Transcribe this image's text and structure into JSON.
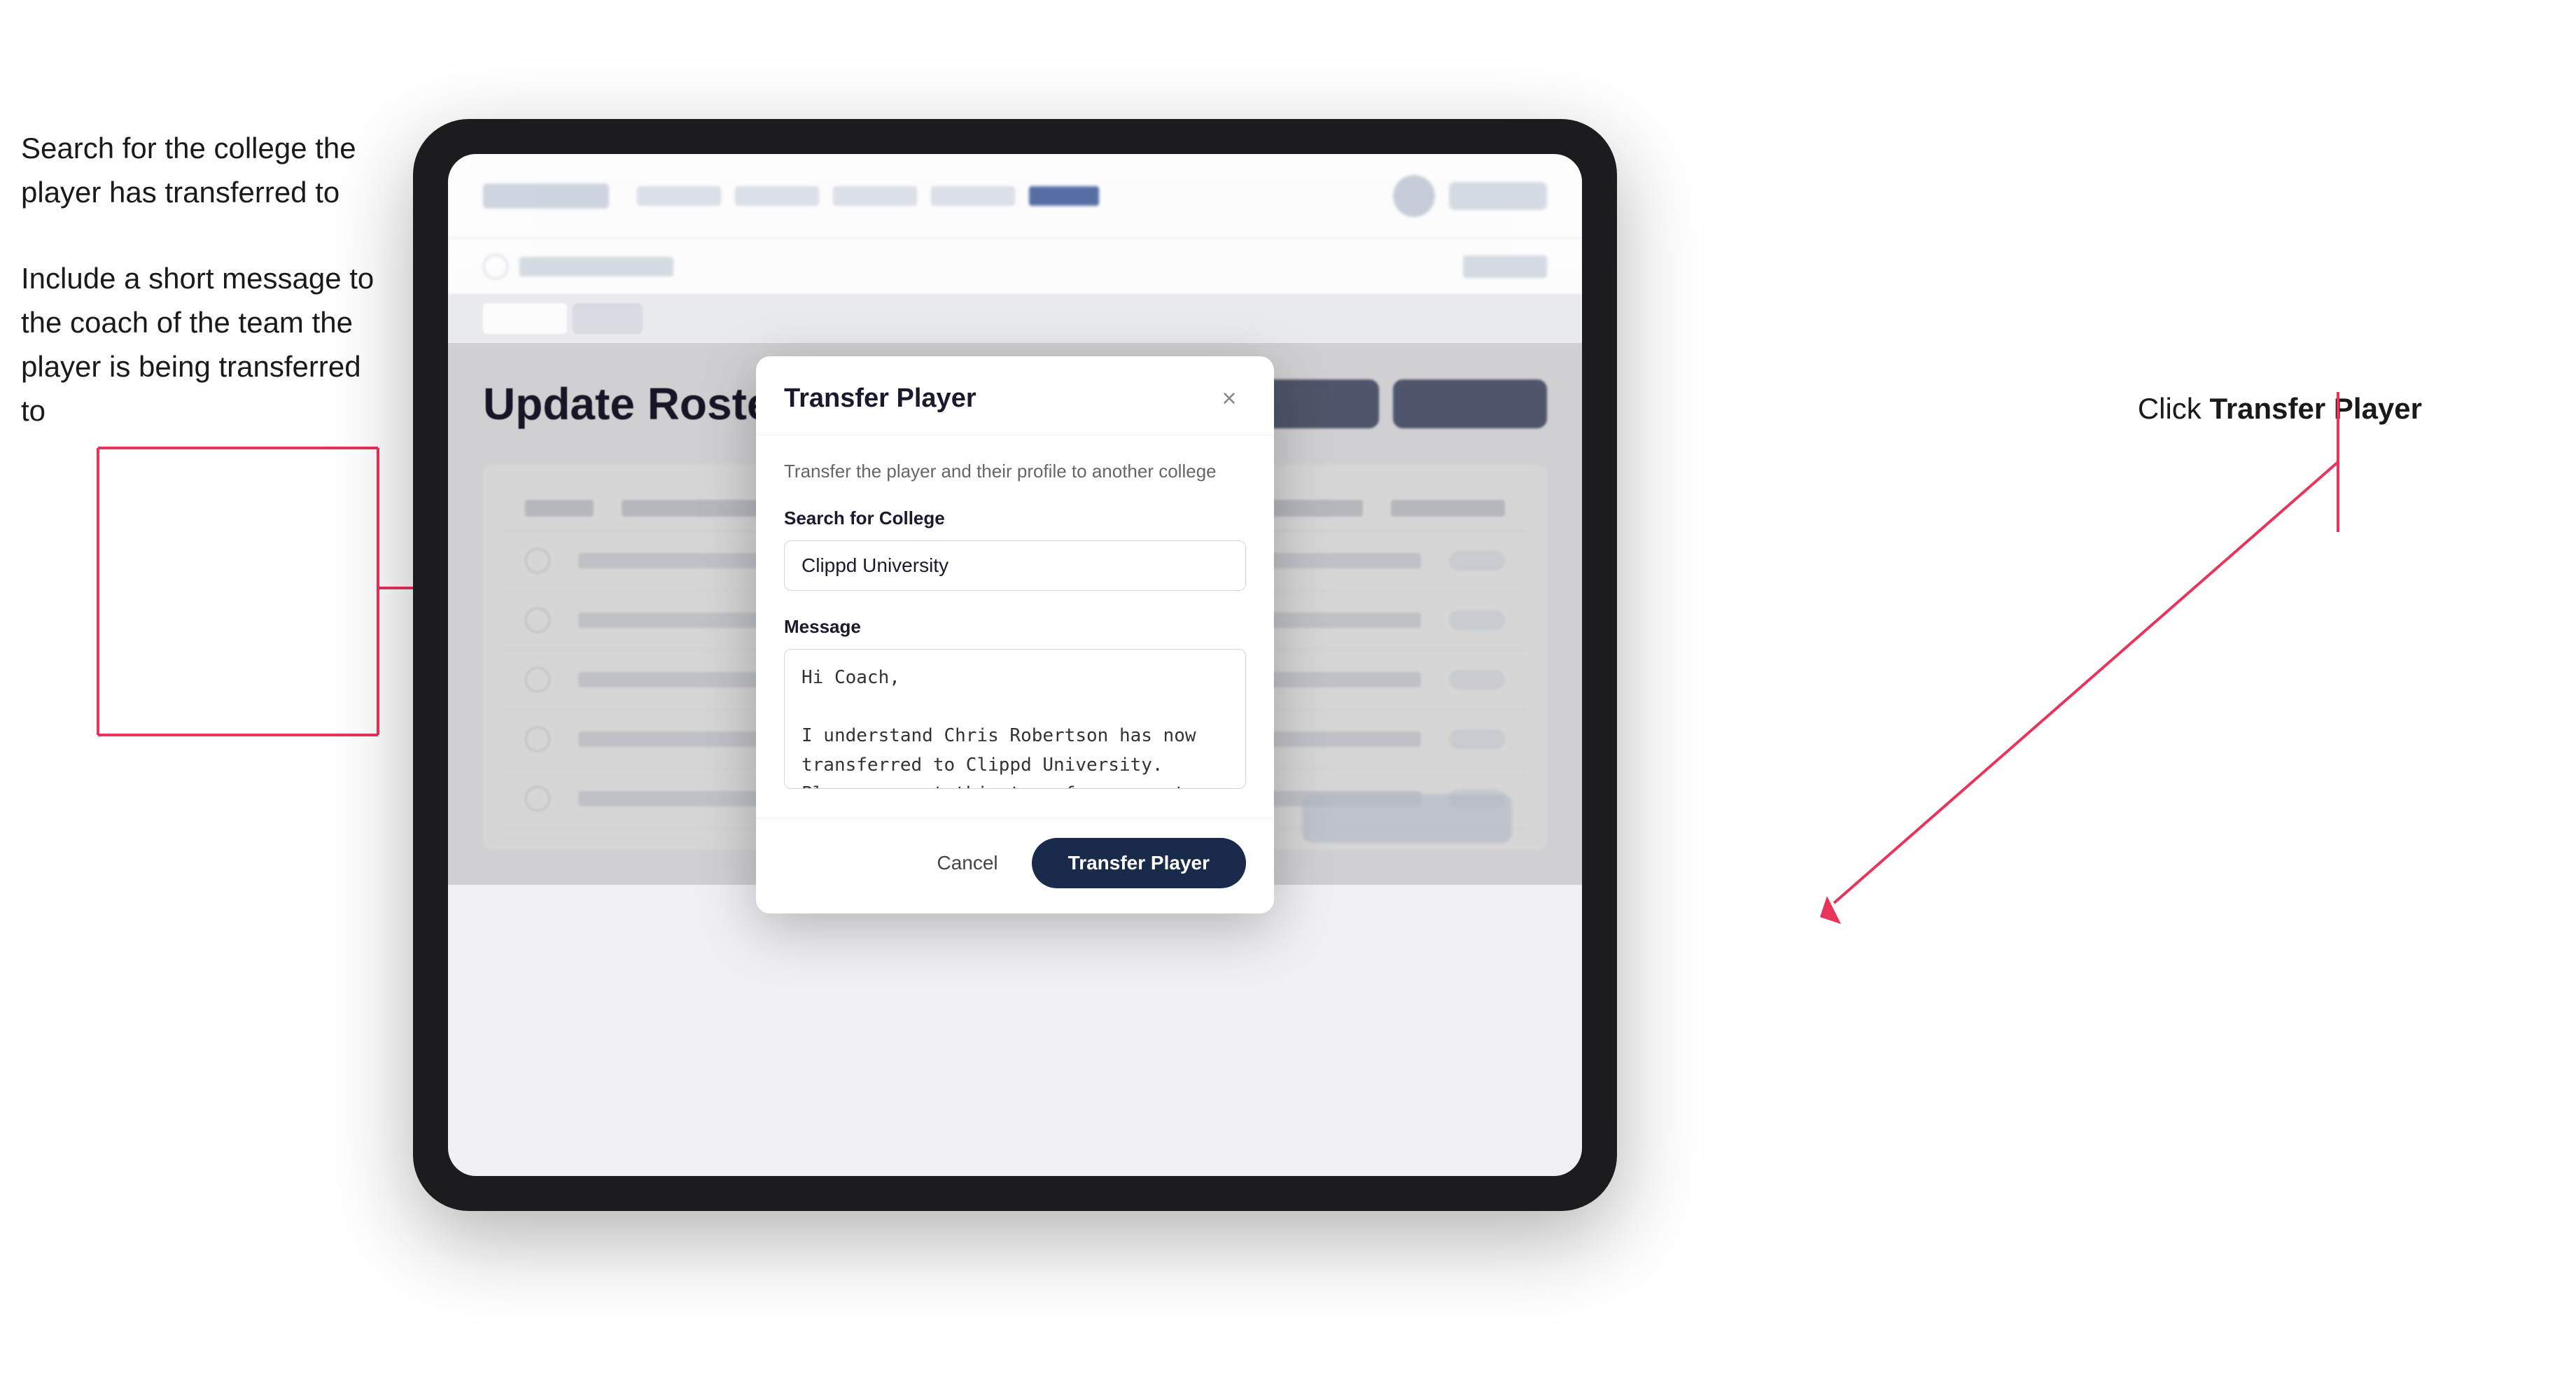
{
  "annotations": {
    "left_text_1": "Search for the college the player has transferred to",
    "left_text_2": "Include a short message to the coach of the team the player is being transferred to",
    "right_text_prefix": "Click ",
    "right_text_bold": "Transfer Player"
  },
  "tablet": {
    "header": {
      "logo_alt": "Clippd logo"
    },
    "page_title": "Update Roster",
    "modal": {
      "title": "Transfer Player",
      "subtitle": "Transfer the player and their profile to another college",
      "search_label": "Search for College",
      "search_value": "Clippd University",
      "search_placeholder": "Search for College",
      "message_label": "Message",
      "message_value": "Hi Coach,\n\nI understand Chris Robertson has now transferred to Clippd University. Please accept this transfer request when you can.",
      "cancel_label": "Cancel",
      "transfer_label": "Transfer Player",
      "close_icon": "×"
    }
  }
}
